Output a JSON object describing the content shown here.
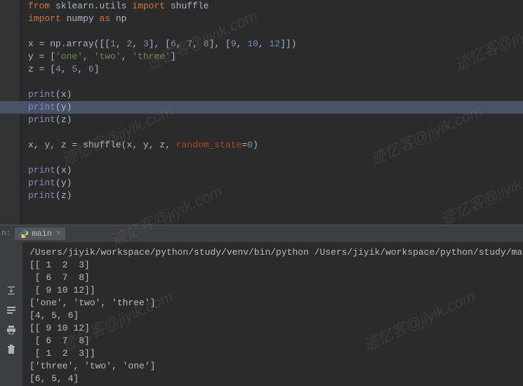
{
  "editor": {
    "highlight_line_index": 8,
    "lines": [
      [
        {
          "t": "from",
          "c": "kw"
        },
        {
          "t": " sklearn",
          "c": "id"
        },
        {
          "t": ".",
          "c": "op"
        },
        {
          "t": "utils ",
          "c": "id"
        },
        {
          "t": "import",
          "c": "kw"
        },
        {
          "t": " shuffle",
          "c": "id"
        }
      ],
      [
        {
          "t": "import",
          "c": "kw"
        },
        {
          "t": " numpy ",
          "c": "id"
        },
        {
          "t": "as",
          "c": "kw"
        },
        {
          "t": " np",
          "c": "id"
        }
      ],
      [],
      [
        {
          "t": "x ",
          "c": "id"
        },
        {
          "t": "=",
          "c": "op"
        },
        {
          "t": " np",
          "c": "id"
        },
        {
          "t": ".",
          "c": "op"
        },
        {
          "t": "array",
          "c": "id"
        },
        {
          "t": "([[",
          "c": "op"
        },
        {
          "t": "1",
          "c": "num"
        },
        {
          "t": ", ",
          "c": "op"
        },
        {
          "t": "2",
          "c": "num"
        },
        {
          "t": ", ",
          "c": "op"
        },
        {
          "t": "3",
          "c": "num"
        },
        {
          "t": "], [",
          "c": "op"
        },
        {
          "t": "6",
          "c": "num"
        },
        {
          "t": ", ",
          "c": "op"
        },
        {
          "t": "7",
          "c": "num"
        },
        {
          "t": ", ",
          "c": "op"
        },
        {
          "t": "8",
          "c": "num"
        },
        {
          "t": "], [",
          "c": "op"
        },
        {
          "t": "9",
          "c": "num"
        },
        {
          "t": ", ",
          "c": "op"
        },
        {
          "t": "10",
          "c": "num"
        },
        {
          "t": ", ",
          "c": "op"
        },
        {
          "t": "12",
          "c": "num"
        },
        {
          "t": "]])",
          "c": "op"
        }
      ],
      [
        {
          "t": "y ",
          "c": "id"
        },
        {
          "t": "=",
          "c": "op"
        },
        {
          "t": " [",
          "c": "op"
        },
        {
          "t": "'one'",
          "c": "str"
        },
        {
          "t": ", ",
          "c": "op"
        },
        {
          "t": "'two'",
          "c": "str"
        },
        {
          "t": ", ",
          "c": "op"
        },
        {
          "t": "'three'",
          "c": "str"
        },
        {
          "t": "]",
          "c": "op"
        }
      ],
      [
        {
          "t": "z ",
          "c": "id"
        },
        {
          "t": "=",
          "c": "op"
        },
        {
          "t": " [",
          "c": "op"
        },
        {
          "t": "4",
          "c": "num"
        },
        {
          "t": ", ",
          "c": "op"
        },
        {
          "t": "5",
          "c": "num"
        },
        {
          "t": ", ",
          "c": "op"
        },
        {
          "t": "6",
          "c": "num"
        },
        {
          "t": "]",
          "c": "op"
        }
      ],
      [],
      [
        {
          "t": "print",
          "c": "builtin"
        },
        {
          "t": "(x)",
          "c": "op"
        }
      ],
      [
        {
          "t": "print",
          "c": "builtin"
        },
        {
          "t": "(",
          "c": "op"
        },
        {
          "t": "y",
          "c": "id"
        },
        {
          "t": ")",
          "c": "op"
        }
      ],
      [
        {
          "t": "print",
          "c": "builtin"
        },
        {
          "t": "(z)",
          "c": "op"
        }
      ],
      [],
      [
        {
          "t": "x",
          "c": "id"
        },
        {
          "t": ", ",
          "c": "op"
        },
        {
          "t": "y",
          "c": "id"
        },
        {
          "t": ", ",
          "c": "op"
        },
        {
          "t": "z ",
          "c": "id"
        },
        {
          "t": "=",
          "c": "op"
        },
        {
          "t": " shuffle(x",
          "c": "id"
        },
        {
          "t": ", ",
          "c": "op"
        },
        {
          "t": "y",
          "c": "id"
        },
        {
          "t": ", ",
          "c": "op"
        },
        {
          "t": "z",
          "c": "id"
        },
        {
          "t": ", ",
          "c": "op"
        },
        {
          "t": "random_state",
          "c": "kwarg"
        },
        {
          "t": "=",
          "c": "op"
        },
        {
          "t": "0",
          "c": "num"
        },
        {
          "t": ")",
          "c": "op"
        }
      ],
      [],
      [
        {
          "t": "print",
          "c": "builtin"
        },
        {
          "t": "(x)",
          "c": "op"
        }
      ],
      [
        {
          "t": "print",
          "c": "builtin"
        },
        {
          "t": "(y)",
          "c": "op"
        }
      ],
      [
        {
          "t": "print",
          "c": "builtin"
        },
        {
          "t": "(z)",
          "c": "op"
        }
      ]
    ]
  },
  "run": {
    "label": "n:",
    "tab_name": "main",
    "console": [
      "/Users/jiyik/workspace/python/study/venv/bin/python /Users/jiyik/workspace/python/study/main.py",
      "[[ 1  2  3]",
      " [ 6  7  8]",
      " [ 9 10 12]]",
      "['one', 'two', 'three']",
      "[4, 5, 6]",
      "[[ 9 10 12]",
      " [ 6  7  8]",
      " [ 1  2  3]]",
      "['three', 'two', 'one']",
      "[6, 5, 4]"
    ]
  },
  "watermark": "迹忆客@jiyik.com"
}
